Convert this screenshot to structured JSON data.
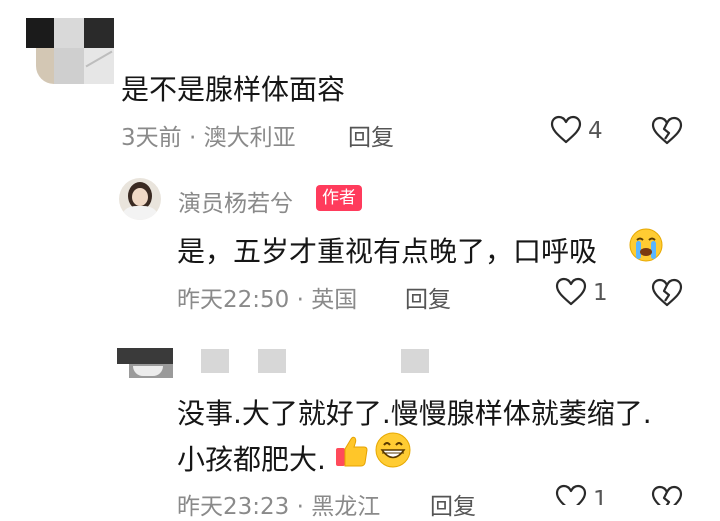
{
  "comment1": {
    "text": "是不是腺样体面容",
    "time_location": "3天前 · 澳大利亚",
    "reply_label": "回复",
    "like_count": "4",
    "icons": [
      "heart-outline-icon",
      "broken-heart-icon"
    ]
  },
  "reply1": {
    "author": "演员杨若兮",
    "badge": "作者",
    "text": "是，五岁才重视有点晚了，口呼吸",
    "emoji": "crying-face-emoji",
    "time_location": "昨天22:50 · 英国",
    "reply_label": "回复",
    "like_count": "1"
  },
  "reply2": {
    "text_line1": "没事.大了就好了.慢慢腺样体就萎缩了.",
    "text_line2": "小孩都肥大.",
    "emojis": [
      "thumbs-up-emoji",
      "grinning-face-emoji"
    ],
    "time_location": "昨天23:23 · 黑龙江",
    "reply_label": "回复",
    "like_count": "1"
  },
  "colors": {
    "text": "#161616",
    "meta": "#8a8a8a",
    "author_badge": "#ff3b5c"
  }
}
